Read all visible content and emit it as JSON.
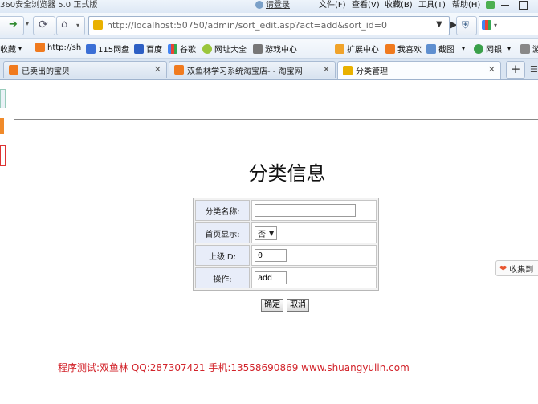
{
  "window": {
    "app_title": "360安全浏览器 5.0 正式版",
    "login": "请登录",
    "menus": [
      "文件(F)",
      "查看(V)",
      "收藏(B)",
      "工具(T)",
      "帮助(H)"
    ]
  },
  "nav": {
    "url": "http://localhost:50750/admin/sort_edit.asp?act=add&sort_id=0"
  },
  "bookmarks": {
    "label": "收藏",
    "items": [
      "http://sh",
      "115网盘",
      "百度",
      "谷歌",
      "网址大全",
      "游戏中心"
    ],
    "right_items": [
      "扩展中心",
      "我喜欢",
      "截图",
      "网银",
      "游"
    ]
  },
  "tabs": [
    {
      "label": "已卖出的宝贝"
    },
    {
      "label": "双鱼林学习系统淘宝店- - 淘宝网"
    },
    {
      "label": "分类管理"
    }
  ],
  "page": {
    "title": "分类信息",
    "form": {
      "name_label": "分类名称:",
      "name_value": "",
      "homepage_label": "首页显示:",
      "homepage_value": "否",
      "parent_label": "上级ID:",
      "parent_value": "0",
      "action_label": "操作:",
      "action_value": "add"
    },
    "buttons": {
      "confirm": "确定",
      "cancel": "取消"
    },
    "footer": "程序测试:双鱼林 QQ:287307421 手机:13558690869 www.shuangyulin.com",
    "collect": "收集到"
  },
  "colors": {
    "footer_text": "#d2232a",
    "label_cell_bg": "#e8edf9",
    "tab_icon": "#f07a1e"
  }
}
